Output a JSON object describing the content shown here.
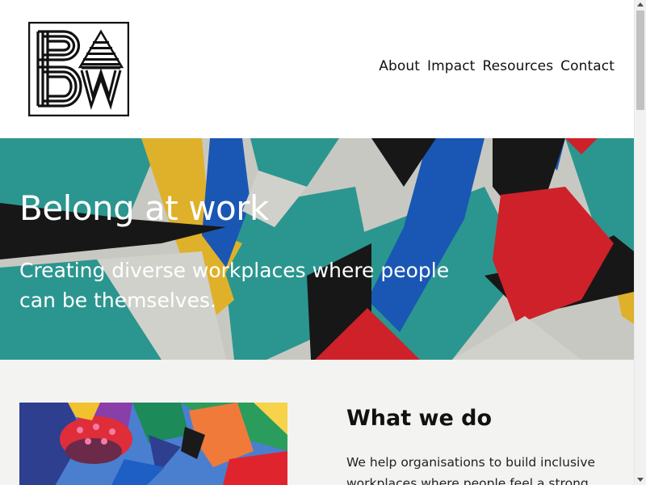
{
  "logo": {
    "icon": "baw-logo-icon"
  },
  "nav": {
    "items": [
      {
        "label": "About"
      },
      {
        "label": "Impact"
      },
      {
        "label": "Resources"
      },
      {
        "label": "Contact"
      }
    ]
  },
  "hero": {
    "title": "Belong at work",
    "subtitle": "Creating diverse workplaces where people can be themselves."
  },
  "section": {
    "title": "What we do",
    "body": "We help organisations to build inclusive workplaces where people feel a strong"
  },
  "colors": {
    "teal": "#2fa39c",
    "blue": "#1d5fc4",
    "yellow": "#f2c12e",
    "red": "#e0242d",
    "black": "#1a1a1a",
    "wall": "#d9d9d4",
    "content_bg": "#f3f3f1"
  }
}
